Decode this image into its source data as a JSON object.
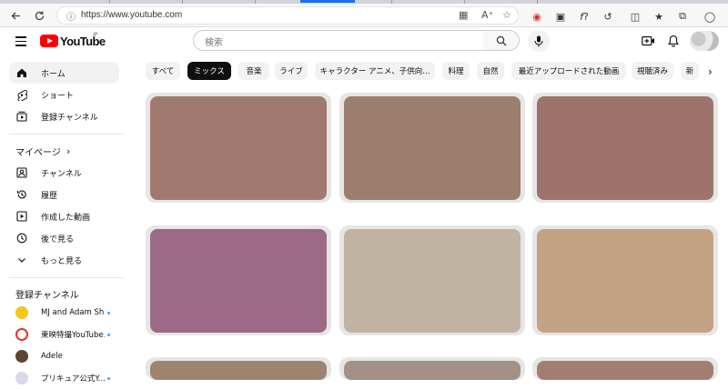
{
  "browser": {
    "url": "https://www.youtube.com",
    "icons": [
      "back-icon",
      "refresh-icon",
      "info-icon",
      "tab-icon",
      "read-aloud-icon",
      "star-icon",
      "media-icon",
      "screenshot-icon",
      "font-icon",
      "copilot-icon",
      "split-icon",
      "favorites-icon",
      "collections-icon",
      "profile-icon"
    ]
  },
  "header": {
    "logo_text": "YouTube",
    "region": "JP",
    "search_placeholder": "検索"
  },
  "sidebar": {
    "main": [
      {
        "label": "ホーム",
        "icon": "home-icon",
        "active": true
      },
      {
        "label": "ショート",
        "icon": "shorts-icon",
        "active": false
      },
      {
        "label": "登録チャンネル",
        "icon": "subscriptions-icon",
        "active": false
      }
    ],
    "you_heading": "マイページ",
    "you_chevron": "›",
    "you_items": [
      {
        "label": "チャンネル",
        "icon": "channel-icon"
      },
      {
        "label": "履歴",
        "icon": "history-icon"
      },
      {
        "label": "作成した動画",
        "icon": "your-videos-icon"
      },
      {
        "label": "後で見る",
        "icon": "watch-later-icon"
      },
      {
        "label": "もっと見る",
        "icon": "show-more-icon"
      }
    ],
    "subs_heading": "登録チャンネル",
    "subscriptions": [
      {
        "label": "MJ and Adam Sh...",
        "new": true,
        "color": "#f5c518"
      },
      {
        "label": "東映特撮YouTube...",
        "new": true,
        "color": "#e0342c"
      },
      {
        "label": "Adele",
        "new": false,
        "color": "#5a4636"
      },
      {
        "label": "プリキュア公式Y...",
        "new": true,
        "color": "#d9d9e8"
      }
    ]
  },
  "chips": [
    "すべて",
    "ミックス",
    "音楽",
    "ライブ",
    "キャラクター アニメ、子供向...",
    "料理",
    "自然",
    "最近アップロードされた動画",
    "視聴済み",
    "新"
  ],
  "selected_chip": "ミックス",
  "chip_next": "›",
  "thumbnails": [
    {
      "color": "#a07a6f"
    },
    {
      "color": "#9c7e6c"
    },
    {
      "color": "#9d736b"
    },
    {
      "color": "#9c6a86"
    },
    {
      "color": "#c0b3a1"
    },
    {
      "color": "#c3a383"
    },
    {
      "color": "#9e846f"
    },
    {
      "color": "#a39188"
    },
    {
      "color": "#a27e70"
    }
  ]
}
